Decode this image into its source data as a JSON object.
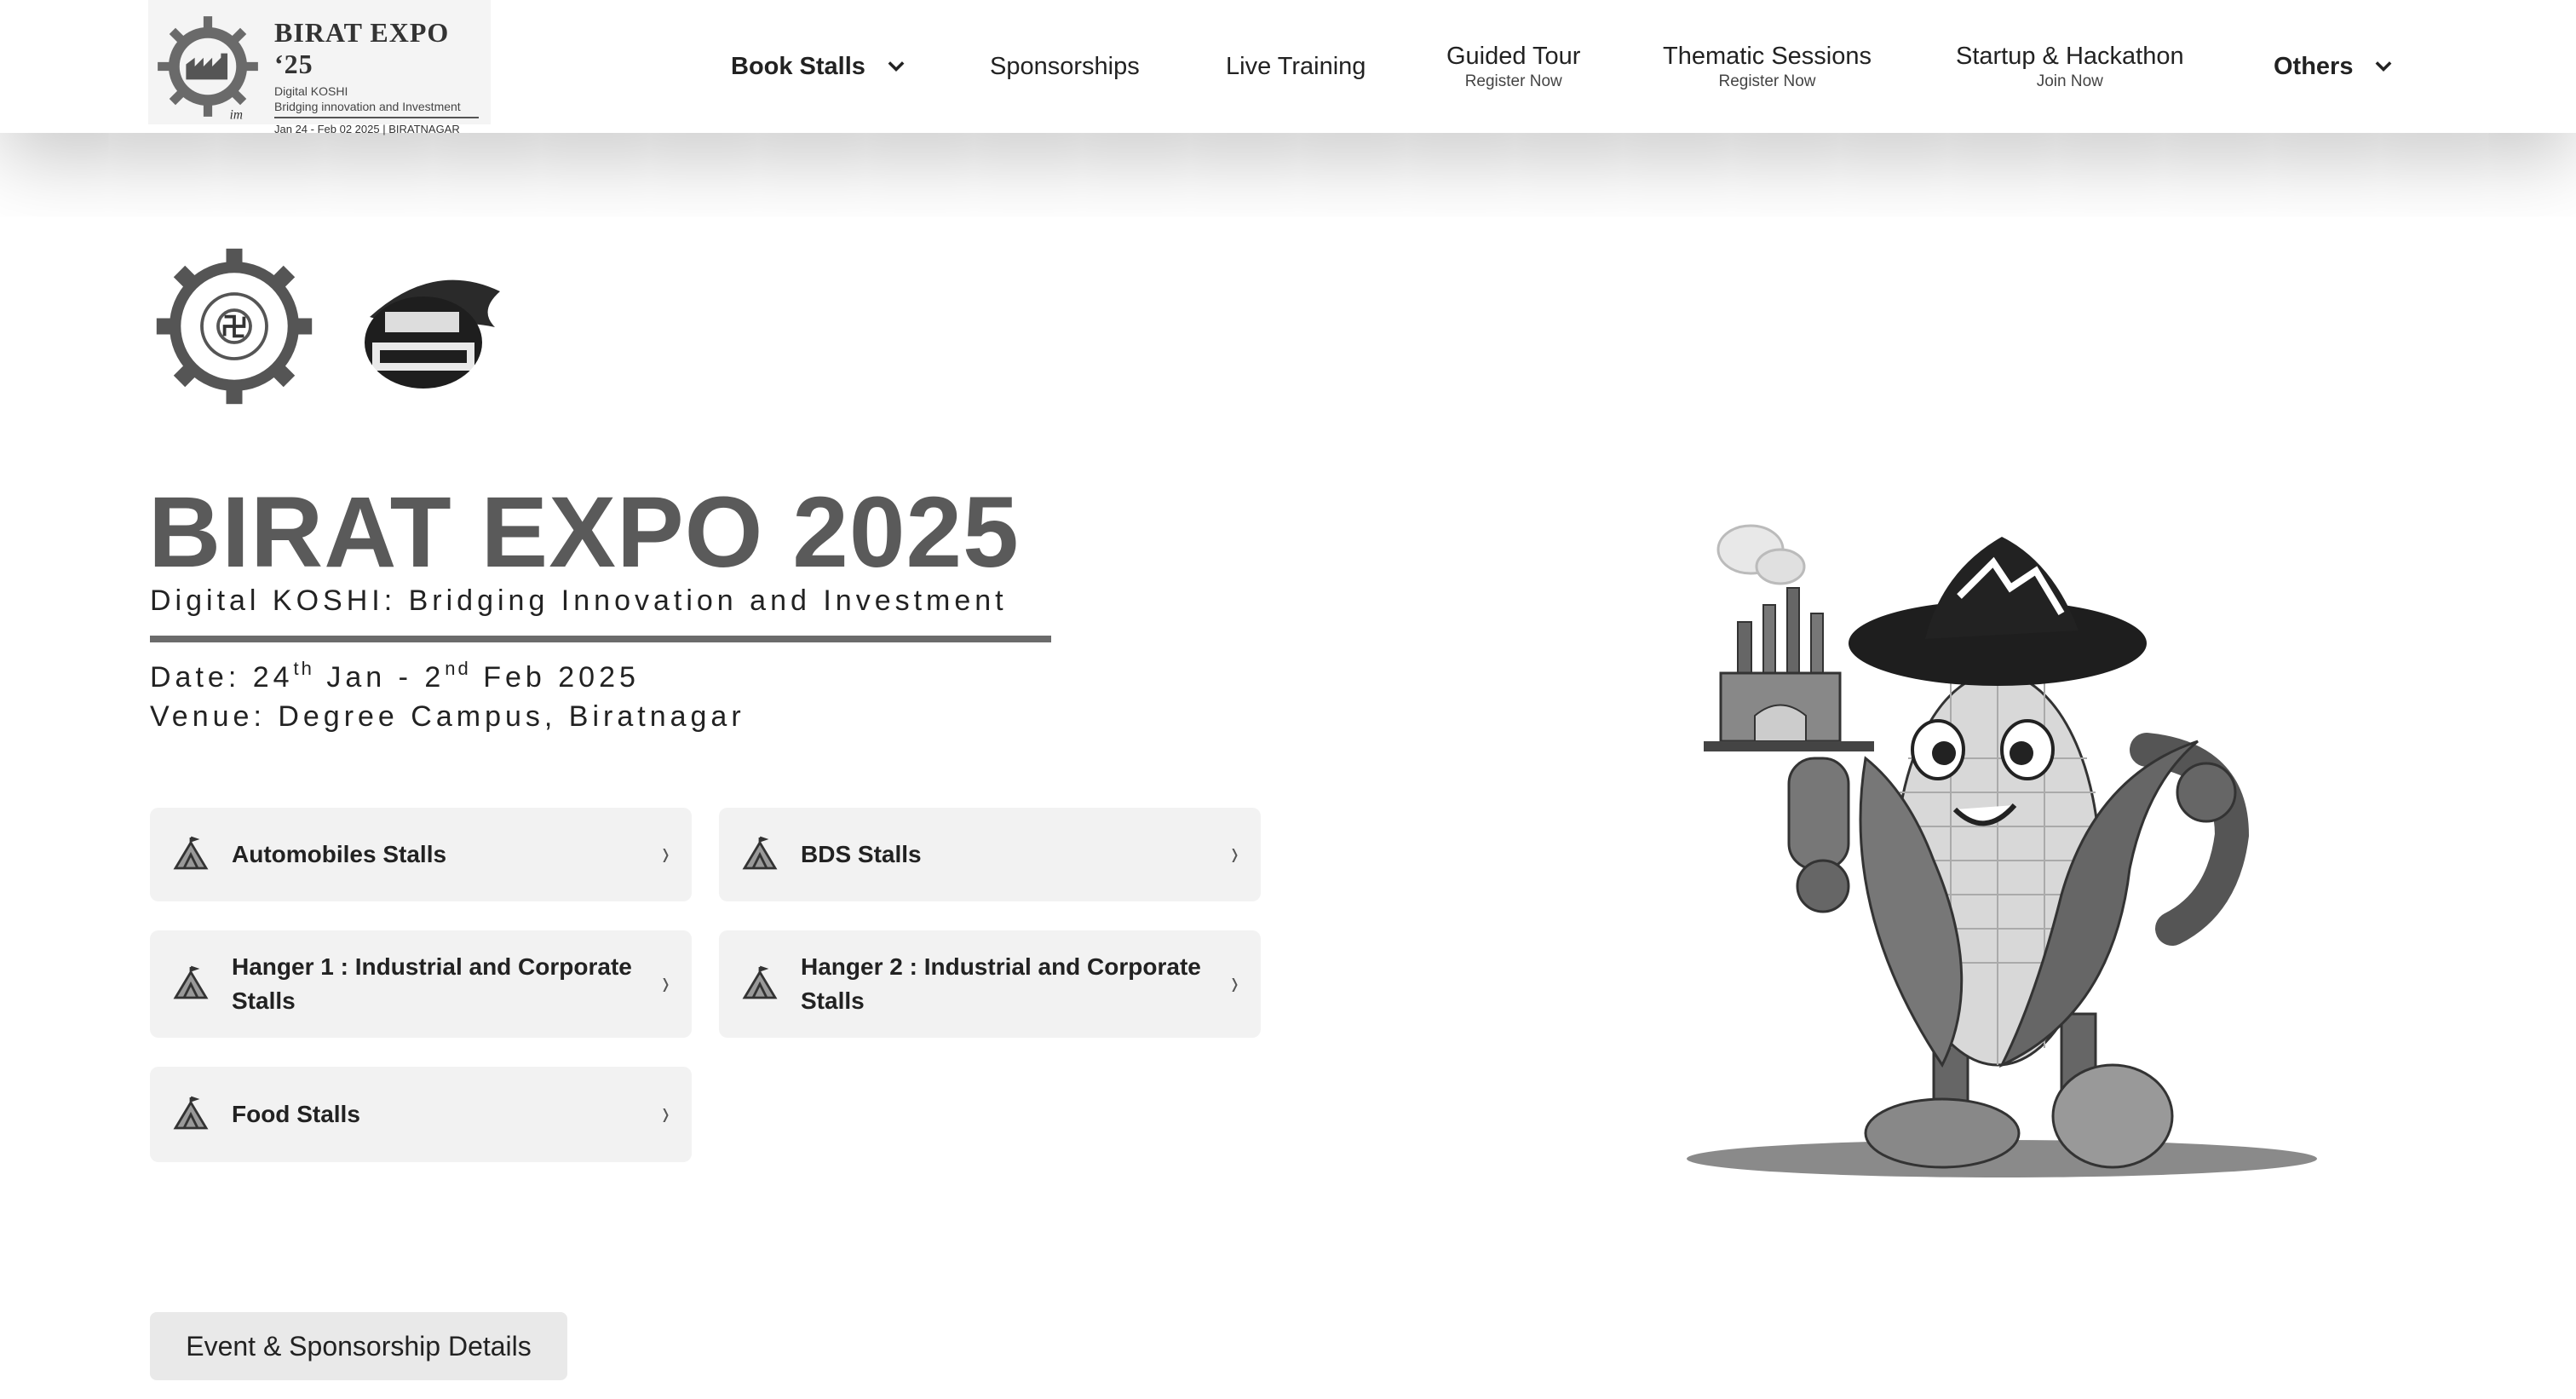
{
  "brand": {
    "title": "BIRAT EXPO ‘25",
    "line1": "Digital KOSHI",
    "line2": "Bridging innovation and Investment",
    "dates": "Jan 24 - Feb 02 2025 | BIRATNAGAR"
  },
  "nav": {
    "book_stalls": "Book Stalls",
    "sponsorships": "Sponsorships",
    "live_training": "Live Training",
    "guided_tour": {
      "label": "Guided Tour",
      "sub": "Register Now"
    },
    "thematic_sessions": {
      "label": "Thematic Sessions",
      "sub": "Register Now"
    },
    "startup": {
      "label": "Startup & Hackathon",
      "sub": "Join Now"
    },
    "others": "Others"
  },
  "hero": {
    "title": "BIRAT EXPO 2025",
    "subtitle": "Digital KOSHI: Bridging Innovation and Investment",
    "date_prefix": "Date: 24",
    "date_sup1": "th",
    "date_mid": " Jan - 2",
    "date_sup2": "nd",
    "date_suffix": " Feb 2025",
    "venue": "Venue: Degree Campus, Biratnagar"
  },
  "stalls": [
    {
      "label": "Automobiles Stalls"
    },
    {
      "label": "BDS Stalls"
    },
    {
      "label": "Hanger 1 : Industrial and Corporate Stalls"
    },
    {
      "label": "Hanger 2 : Industrial and Corporate Stalls"
    },
    {
      "label": "Food Stalls"
    }
  ],
  "details_button": "Event & Sponsorship Details",
  "icons": {
    "card": "tent-icon",
    "arrow": "chevron-right-icon",
    "dropdown": "chevron-down-icon"
  },
  "colors": {
    "accent": "#5a5a5a",
    "card_bg": "#f2f2f2",
    "button_bg": "#e9e9e9"
  }
}
